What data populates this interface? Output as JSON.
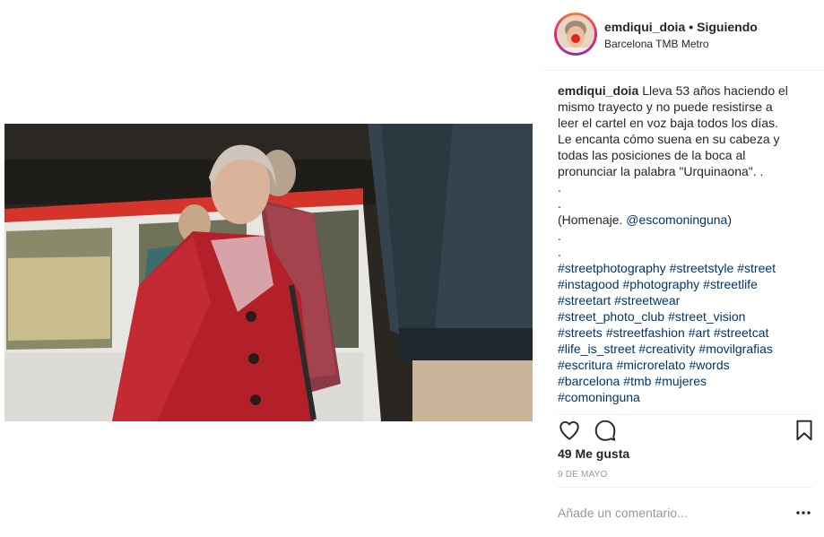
{
  "post": {
    "username": "emdiqui_doia",
    "follow_status": "Siguiendo",
    "separator": "•",
    "location": "Barcelona TMB Metro",
    "caption_lines": [
      "Lleva 53 años haciendo el",
      "mismo trayecto y no puede resistirse a",
      "leer el cartel en voz baja todos los días.",
      "Le encanta cómo suena en su cabeza y",
      "todas las posiciones de la boca al",
      "pronunciar la palabra \"Urquinaona\". .",
      ".",
      ".",
      "(Homenaje. ",
      ".",
      "."
    ],
    "mention": "@escomoninguna",
    "mention_suffix": ")",
    "hashtags": [
      "#streetphotography",
      "#streetstyle",
      "#street",
      "#instagood",
      "#photography",
      "#streetlife",
      "#streetart",
      "#streetwear",
      "#street_photo_club",
      "#street_vision",
      "#streets",
      "#streetfashion",
      "#art",
      "#streetcat",
      "#life_is_street",
      "#creativity",
      "#movilgrafias",
      "#escritura",
      "#microrelato",
      "#words",
      "#barcelona",
      "#tmb",
      "#mujeres",
      "#comoninguna"
    ],
    "likes": "49 Me gusta",
    "date": "9 DE MAYO",
    "comment_placeholder": "Añade un comentario...",
    "icons": {
      "like": "heart-icon",
      "comment": "comment-icon",
      "save": "bookmark-icon",
      "more": "more-dots-icon"
    }
  },
  "colors": {
    "text": "#262626",
    "link": "#003569",
    "muted": "#999999",
    "border": "#efefef"
  }
}
